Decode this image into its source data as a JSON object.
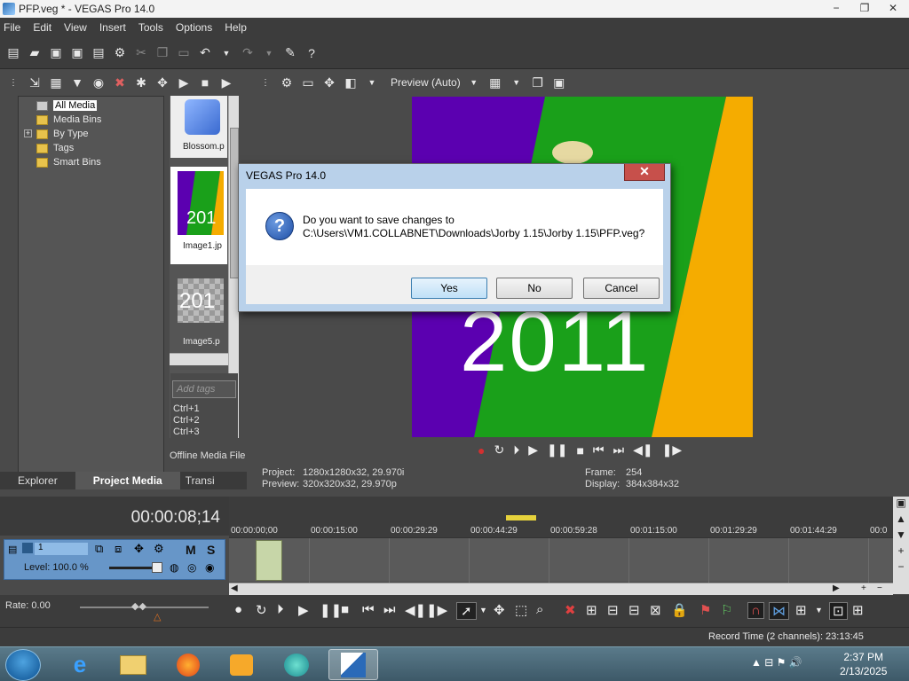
{
  "window": {
    "title": "PFP.veg * - VEGAS Pro 14.0",
    "minimize": "−",
    "maximize": "❐",
    "close": "✕"
  },
  "menu": [
    "File",
    "Edit",
    "View",
    "Insert",
    "Tools",
    "Options",
    "Help"
  ],
  "explorer": {
    "tree": [
      "All Media",
      "Media Bins",
      "By Type",
      "Tags",
      "Smart Bins"
    ],
    "expand_glyph": "+",
    "thumbs": [
      "Blossom.p",
      "Image1.jp",
      "Image5.p"
    ],
    "thumb_overlay_text": [
      "201",
      "201"
    ],
    "add_tags_placeholder": "Add tags",
    "shortcuts": [
      "Ctrl+1",
      "Ctrl+2",
      "Ctrl+3"
    ],
    "offline_label": "Offline Media File",
    "tabs": [
      "Explorer",
      "Project Media",
      "Transi"
    ]
  },
  "preview": {
    "mode_label": "Preview (Auto)",
    "video_text": "2011",
    "project_label": "Project:",
    "project_value": "1280x1280x32, 29.970i",
    "preview_label": "Preview:",
    "preview_value": "320x320x32, 29.970p",
    "frame_label": "Frame:",
    "frame_value": "254",
    "display_label": "Display:",
    "display_value": "384x384x32"
  },
  "timeline": {
    "timecode": "00:00:08;14",
    "ruler": [
      "00:00:00;00",
      "00:00:15:00",
      "00:00:29:29",
      "00:00:44:29",
      "00:00:59:28",
      "00:01:15:00",
      "00:01:29:29",
      "00:01:44:29",
      "00:0"
    ],
    "track_number": "1",
    "level_label": "Level: 100.0 %",
    "mute": "M",
    "solo": "S"
  },
  "transport": {
    "rate_label": "Rate: 0.00",
    "record_time": "Record Time (2 channels): 23:13:45"
  },
  "dialog": {
    "title": "VEGAS Pro 14.0",
    "question_mark": "?",
    "message_line1": "Do you want to save changes to",
    "message_line2": "C:\\Users\\VM1.COLLABNET\\Downloads\\Jorby 1.15\\Jorby 1.15\\PFP.veg?",
    "yes": "Yes",
    "no": "No",
    "cancel": "Cancel",
    "close_glyph": "✕"
  },
  "taskbar": {
    "time": "2:37 PM",
    "date": "2/13/2025"
  },
  "colors": {
    "video_purple": "#5b00b0",
    "video_green": "#1aa01a",
    "video_yellow": "#f5ac00",
    "dialog_close": "#c7504b",
    "track_header": "#6796c8"
  }
}
